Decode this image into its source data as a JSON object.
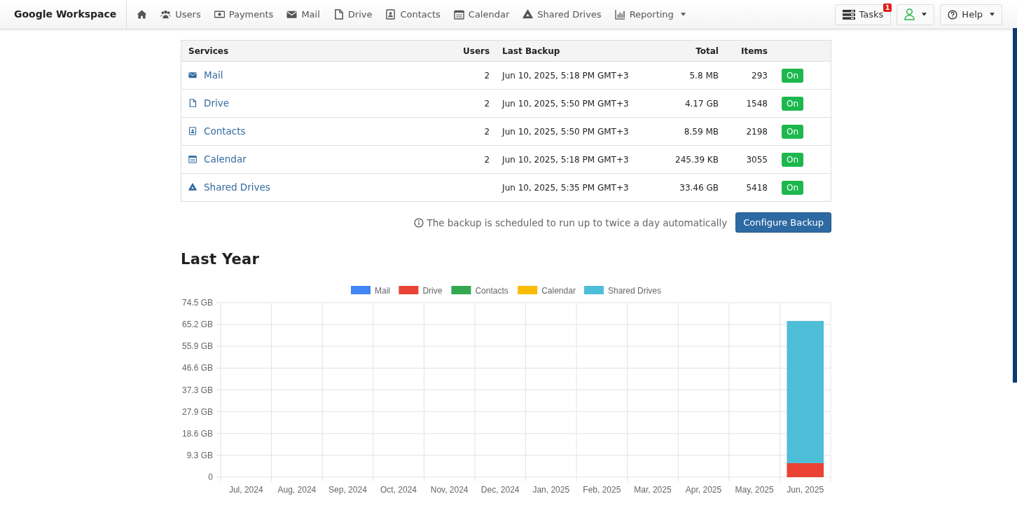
{
  "navbar": {
    "brand": "Google Workspace",
    "items": [
      {
        "kind": "home"
      },
      {
        "kind": "users",
        "label": "Users"
      },
      {
        "kind": "payments",
        "label": "Payments"
      },
      {
        "kind": "mail",
        "label": "Mail"
      },
      {
        "kind": "drive",
        "label": "Drive"
      },
      {
        "kind": "contacts",
        "label": "Contacts"
      },
      {
        "kind": "calendar",
        "label": "Calendar"
      },
      {
        "kind": "shared_drives",
        "label": "Shared Drives"
      },
      {
        "kind": "reporting",
        "label": "Reporting",
        "dropdown": true
      }
    ],
    "tasks": {
      "label": "Tasks",
      "badge": "1"
    },
    "help": {
      "label": "Help"
    }
  },
  "table": {
    "columns": [
      "Services",
      "Users",
      "Last Backup",
      "Total",
      "Items"
    ],
    "rows": [
      {
        "kind": "mail",
        "service": "Mail",
        "users": "2",
        "last_backup": "Jun 10, 2025, 5:18 PM GMT+3",
        "total": "5.8 MB",
        "items": "293",
        "status": {
          "label": "On",
          "on": true
        }
      },
      {
        "kind": "drive",
        "service": "Drive",
        "users": "2",
        "last_backup": "Jun 10, 2025, 5:50 PM GMT+3",
        "total": "4.17 GB",
        "items": "1548",
        "status": {
          "label": "On",
          "on": true
        }
      },
      {
        "kind": "contacts",
        "service": "Contacts",
        "users": "2",
        "last_backup": "Jun 10, 2025, 5:50 PM GMT+3",
        "total": "8.59 MB",
        "items": "2198",
        "status": {
          "label": "On",
          "on": true
        }
      },
      {
        "kind": "calendar",
        "service": "Calendar",
        "users": "2",
        "last_backup": "Jun 10, 2025, 5:18 PM GMT+3",
        "total": "245.39 KB",
        "items": "3055",
        "status": {
          "label": "On",
          "on": true
        }
      },
      {
        "kind": "shared_drives",
        "service": "Shared Drives",
        "last_backup": "Jun 10, 2025, 5:35 PM GMT+3",
        "total": "33.46 GB",
        "items": "5418",
        "status": {
          "label": "On",
          "on": true
        }
      }
    ]
  },
  "schedule_note": "The backup is scheduled to run up to twice a day automatically",
  "configure_button": "Configure Backup",
  "section_title": "Last Year",
  "chart_data": {
    "type": "bar",
    "stacked": true,
    "grid": true,
    "legend": true,
    "categories": [
      "Jul, 2024",
      "Aug, 2024",
      "Sep, 2024",
      "Oct, 2024",
      "Nov, 2024",
      "Dec, 2024",
      "Jan, 2025",
      "Feb, 2025",
      "Mar, 2025",
      "Apr, 2025",
      "May, 2025",
      "Jun, 2025"
    ],
    "series": [
      {
        "name": "Mail",
        "color": "#4285f4",
        "values": [
          0,
          0,
          0,
          0,
          0,
          0,
          0,
          0,
          0,
          0,
          0,
          0
        ]
      },
      {
        "name": "Drive",
        "color": "#ea4335",
        "values": [
          0,
          0,
          0,
          0,
          0,
          0,
          0,
          0,
          0,
          0,
          0,
          6.0
        ]
      },
      {
        "name": "Contacts",
        "color": "#34a853",
        "values": [
          0,
          0,
          0,
          0,
          0,
          0,
          0,
          0,
          0,
          0,
          0,
          0
        ]
      },
      {
        "name": "Calendar",
        "color": "#fbbc05",
        "values": [
          0,
          0,
          0,
          0,
          0,
          0,
          0,
          0,
          0,
          0,
          0,
          0
        ]
      },
      {
        "name": "Shared Drives",
        "color": "#4ebdd8",
        "values": [
          0,
          0,
          0,
          0,
          0,
          0,
          0,
          0,
          0,
          0,
          0,
          60.7
        ]
      }
    ],
    "ylim": [
      0,
      74.5
    ],
    "yticks": [
      {
        "value": 0,
        "label": "0"
      },
      {
        "value": 9.31,
        "label": "9.3 GB"
      },
      {
        "value": 18.63,
        "label": "18.6 GB"
      },
      {
        "value": 27.94,
        "label": "27.9 GB"
      },
      {
        "value": 37.25,
        "label": "37.3 GB"
      },
      {
        "value": 46.56,
        "label": "46.6 GB"
      },
      {
        "value": 55.88,
        "label": "55.9 GB"
      },
      {
        "value": 65.19,
        "label": "65.2 GB"
      },
      {
        "value": 74.5,
        "label": "74.5 GB"
      }
    ]
  }
}
